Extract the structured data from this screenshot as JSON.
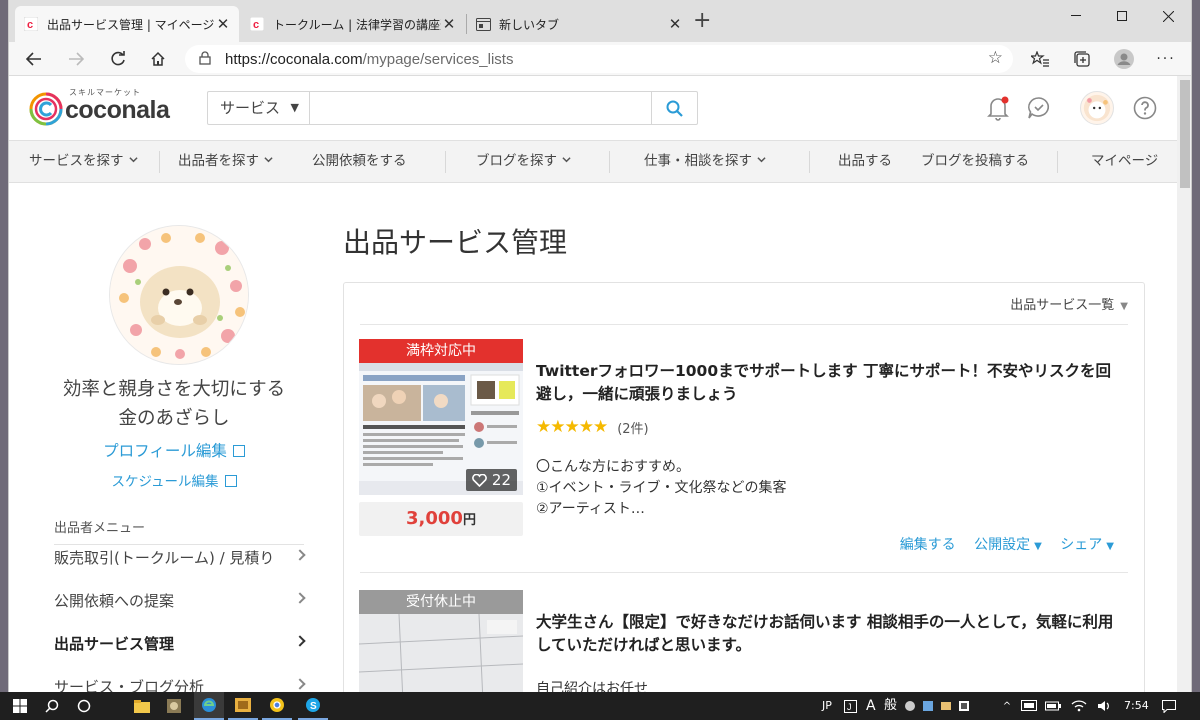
{
  "browser": {
    "tabs": [
      {
        "title": "出品サービス管理 | マイページ | ココナ"
      },
      {
        "title": "トークルーム | 法律学習の講座選びや"
      },
      {
        "title": "新しいタブ"
      }
    ],
    "url_host": "https://coconala.com",
    "url_path": "/mypage/services_lists"
  },
  "site": {
    "logo_tagline": "スキルマーケット",
    "logo_word": "coconala",
    "search": {
      "category": "サービス",
      "placeholder": ""
    },
    "nav": [
      "サービスを探す",
      "出品者を探す",
      "公開依頼をする",
      "ブログを探す",
      "仕事・相談を探す",
      "出品する",
      "ブログを投稿する",
      "マイページ"
    ]
  },
  "sidebar": {
    "user_line1": "効率と親身さを大切にする",
    "user_line2": "金のあざらし",
    "profile_edit": "プロフィール編集",
    "schedule_edit": "スケジュール編集",
    "menu_heading": "出品者メニュー",
    "menu": [
      {
        "label": "販売取引(トークルーム) / 見積り"
      },
      {
        "label": "公開依頼への提案"
      },
      {
        "label": "出品サービス管理"
      },
      {
        "label": "サービス・ブログ分析"
      }
    ]
  },
  "main": {
    "title": "出品サービス管理",
    "list_selector": "出品サービス一覧",
    "services": [
      {
        "status": "満枠対応中",
        "status_color": "#e3312d",
        "likes": "22",
        "price": "3,000",
        "currency": "円",
        "title": "Twitterフォロワー1000までサポートします 丁寧にサポート！不安やリスクを回避し，一緒に頑張りましょう",
        "stars": "★★★★★",
        "reviews": "(2件)",
        "desc1": "〇こんな方におすすめ。",
        "desc2": "①イベント・ライブ・文化祭などの集客",
        "desc3": "②アーティスト…",
        "actions": {
          "edit": "編集する",
          "visibility": "公開設定",
          "share": "シェア"
        }
      },
      {
        "status": "受付休止中",
        "status_color": "#9a9a9a",
        "title": "大学生さん【限定】で好きなだけお話伺います 相談相手の一人として，気軽に利用していただければと思います。",
        "desc1": "自己紹介はお任せ"
      }
    ]
  },
  "taskbar": {
    "ime_lang": "JP",
    "ime_a": "A",
    "ime_mode": "般",
    "time": "7:54"
  }
}
